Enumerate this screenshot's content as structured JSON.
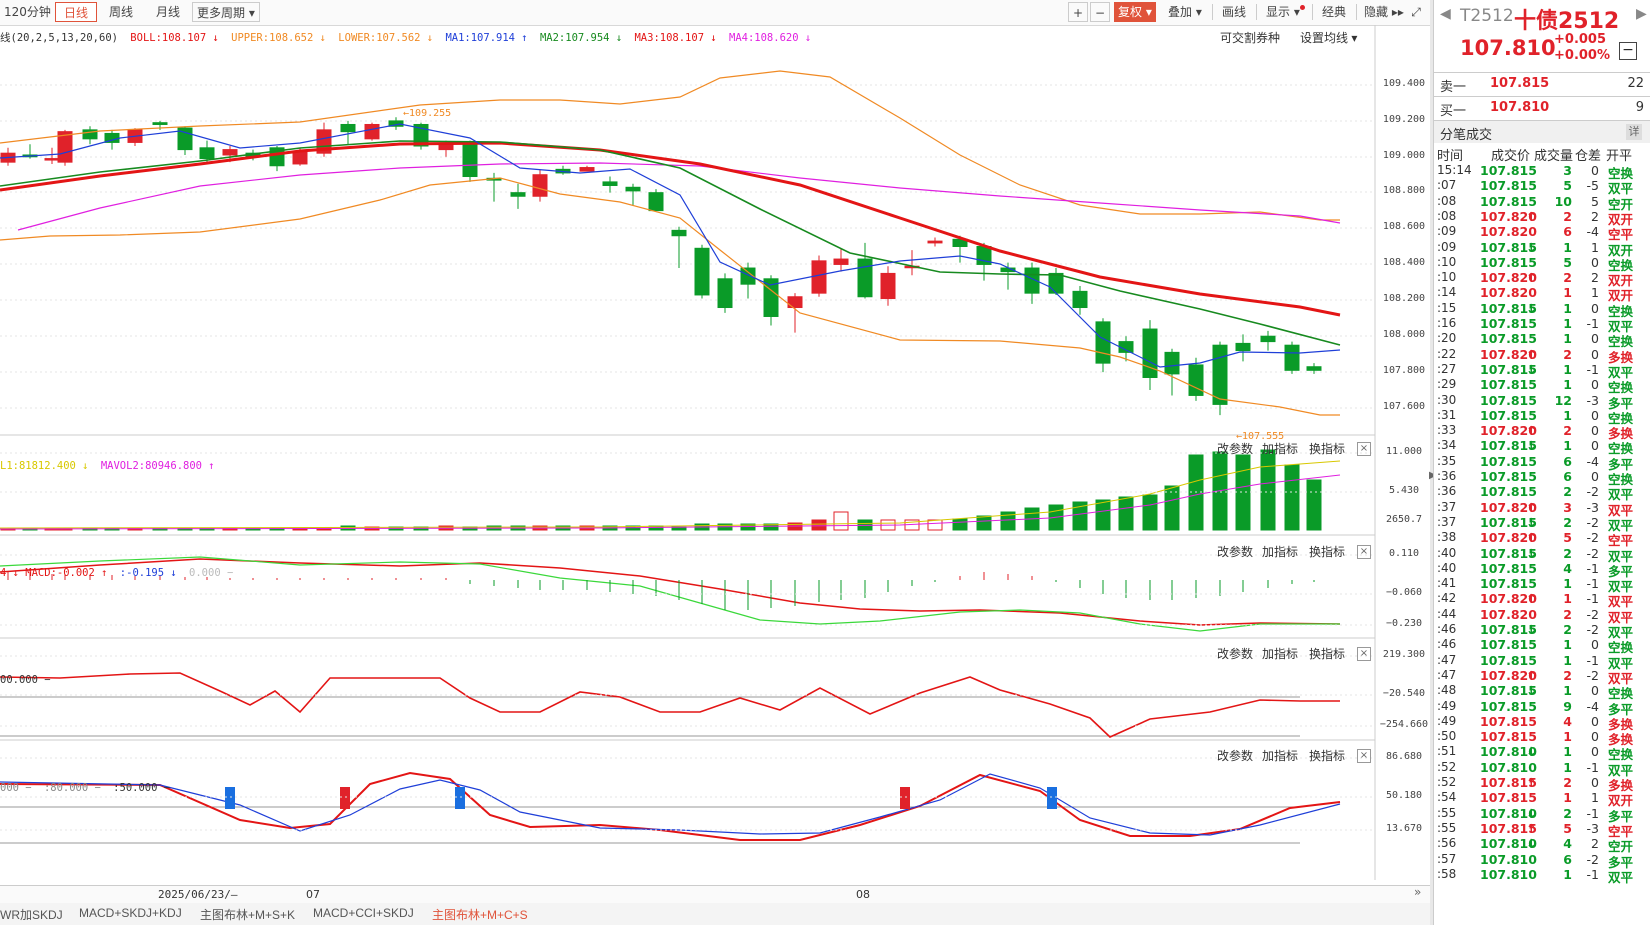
{
  "toolbar": {
    "periods": [
      "120分钟",
      "日线",
      "周线",
      "月线",
      "更多周期 ▾"
    ],
    "active_period": "日线",
    "right_tools": [
      "+",
      "−",
      "复权 ▾",
      "叠加 ▾",
      "画线",
      "显示 ▾",
      "经典",
      "隐藏 ▸▸",
      "⤢"
    ]
  },
  "legend_main": {
    "prefix": "线(20,2,5,13,20,60)",
    "boll": "BOLL:108.107 ↓",
    "upper": "UPPER:108.652 ↓",
    "lower": "LOWER:107.562 ↓",
    "ma1": "MA1:107.914 ↑",
    "ma2": "MA2:107.954 ↓",
    "ma3": "MA3:108.107 ↓",
    "ma4": "MA4:108.620 ↓",
    "link1": "可交割券种",
    "link2": "设置均线 ▾"
  },
  "main_axis": [
    "109.400",
    "109.200",
    "109.000",
    "108.800",
    "108.600",
    "108.400",
    "108.200",
    "108.000",
    "107.800",
    "107.600"
  ],
  "annot_high": "109.255",
  "annot_low": "107.555",
  "vol_legend": {
    "a": "L1:81812.400 ↓",
    "b": "MAVOL2:80946.800 ↑"
  },
  "vol_axis": [
    "11.000",
    "5.430",
    "2650.7"
  ],
  "macd_legend": {
    "a": "4 ↓ MACD:-0.002 ↑",
    "b": ":-0.195 ↓",
    "c": "0.000 −"
  },
  "macd_axis": [
    "0.110",
    "−0.060",
    "−0.230"
  ],
  "cci_legend": "00.000 −",
  "cci_axis": [
    "219.300",
    "−20.540",
    "−254.660"
  ],
  "kdj_legend": {
    "a": "000 − ",
    "b": ":80.000 −",
    "c": ":50.000 −"
  },
  "kdj_axis": [
    "86.680",
    "50.180",
    "13.670"
  ],
  "panel_buttons": [
    "改参数",
    "加指标",
    "换指标"
  ],
  "date_labels": {
    "start": "2025/06/23/—",
    "m07": "07",
    "m08": "08"
  },
  "bottom_tabs": [
    "WR加SKDJ",
    "MACD+SKDJ+KDJ",
    "主图布林+M+S+K",
    "MACD+CCI+SKDJ",
    "主图布林+M+C+S"
  ],
  "active_tab": "主图布林+M+C+S",
  "quote": {
    "code": "T2512",
    "name": "十债2512",
    "price": "107.810",
    "change": "+0.005",
    "change_pct": "+0.00%",
    "sell_label": "卖一",
    "sell_price": "107.815",
    "sell_vol": "22",
    "buy_label": "买一",
    "buy_price": "107.810",
    "buy_vol": "9"
  },
  "tick_panel": {
    "title": "分笔成交",
    "detail": "详",
    "headers": [
      "时间",
      "成交价",
      "成交量",
      "仓差",
      "开平"
    ]
  },
  "ticks": [
    {
      "t": "15:14",
      "p": "107.815",
      "a": "",
      "v": "3",
      "d": "0",
      "k": "空换",
      "c": "dn"
    },
    {
      "t": ":07",
      "p": "107.815",
      "a": "",
      "v": "5",
      "d": "-5",
      "k": "双平",
      "c": "dn"
    },
    {
      "t": ":08",
      "p": "107.815",
      "a": "",
      "v": "10",
      "d": "5",
      "k": "空开",
      "c": "dn"
    },
    {
      "t": ":08",
      "p": "107.820",
      "a": "↑",
      "v": "2",
      "d": "2",
      "k": "双开",
      "c": "up"
    },
    {
      "t": ":09",
      "p": "107.820",
      "a": "",
      "v": "6",
      "d": "-4",
      "k": "空平",
      "c": "up"
    },
    {
      "t": ":09",
      "p": "107.815",
      "a": "↓",
      "v": "1",
      "d": "1",
      "k": "双开",
      "c": "dn"
    },
    {
      "t": ":10",
      "p": "107.815",
      "a": "",
      "v": "5",
      "d": "0",
      "k": "空换",
      "c": "dn"
    },
    {
      "t": ":10",
      "p": "107.820",
      "a": "↑",
      "v": "2",
      "d": "2",
      "k": "双开",
      "c": "up"
    },
    {
      "t": ":14",
      "p": "107.820",
      "a": "",
      "v": "1",
      "d": "1",
      "k": "双开",
      "c": "up"
    },
    {
      "t": ":15",
      "p": "107.815",
      "a": "↓",
      "v": "1",
      "d": "0",
      "k": "空换",
      "c": "dn"
    },
    {
      "t": ":16",
      "p": "107.815",
      "a": "",
      "v": "1",
      "d": "-1",
      "k": "双平",
      "c": "dn"
    },
    {
      "t": ":20",
      "p": "107.815",
      "a": "",
      "v": "1",
      "d": "0",
      "k": "空换",
      "c": "dn"
    },
    {
      "t": ":22",
      "p": "107.820",
      "a": "↑",
      "v": "2",
      "d": "0",
      "k": "多换",
      "c": "up"
    },
    {
      "t": ":27",
      "p": "107.815",
      "a": "↓",
      "v": "1",
      "d": "-1",
      "k": "双平",
      "c": "dn"
    },
    {
      "t": ":29",
      "p": "107.815",
      "a": "",
      "v": "1",
      "d": "0",
      "k": "空换",
      "c": "dn"
    },
    {
      "t": ":30",
      "p": "107.815",
      "a": "",
      "v": "12",
      "d": "-3",
      "k": "多平",
      "c": "dn"
    },
    {
      "t": ":31",
      "p": "107.815",
      "a": "",
      "v": "1",
      "d": "0",
      "k": "空换",
      "c": "dn"
    },
    {
      "t": ":33",
      "p": "107.820",
      "a": "↑",
      "v": "2",
      "d": "0",
      "k": "多换",
      "c": "up"
    },
    {
      "t": ":34",
      "p": "107.815",
      "a": "↓",
      "v": "1",
      "d": "0",
      "k": "空换",
      "c": "dn"
    },
    {
      "t": ":35",
      "p": "107.815",
      "a": "",
      "v": "6",
      "d": "-4",
      "k": "多平",
      "c": "dn"
    },
    {
      "t": ":36",
      "p": "107.815",
      "a": "",
      "v": "6",
      "d": "0",
      "k": "空换",
      "c": "dn"
    },
    {
      "t": ":36",
      "p": "107.815",
      "a": "",
      "v": "2",
      "d": "-2",
      "k": "双平",
      "c": "dn"
    },
    {
      "t": ":37",
      "p": "107.820",
      "a": "↑",
      "v": "3",
      "d": "-3",
      "k": "双平",
      "c": "up"
    },
    {
      "t": ":37",
      "p": "107.815",
      "a": "↓",
      "v": "2",
      "d": "-2",
      "k": "双平",
      "c": "dn"
    },
    {
      "t": ":38",
      "p": "107.820",
      "a": "↑",
      "v": "5",
      "d": "-2",
      "k": "空平",
      "c": "up"
    },
    {
      "t": ":40",
      "p": "107.815",
      "a": "↓",
      "v": "2",
      "d": "-2",
      "k": "双平",
      "c": "dn"
    },
    {
      "t": ":40",
      "p": "107.815",
      "a": "",
      "v": "4",
      "d": "-1",
      "k": "多平",
      "c": "dn"
    },
    {
      "t": ":41",
      "p": "107.815",
      "a": "",
      "v": "1",
      "d": "-1",
      "k": "双平",
      "c": "dn"
    },
    {
      "t": ":42",
      "p": "107.820",
      "a": "↑",
      "v": "1",
      "d": "-1",
      "k": "双平",
      "c": "up"
    },
    {
      "t": ":44",
      "p": "107.820",
      "a": "",
      "v": "2",
      "d": "-2",
      "k": "双平",
      "c": "up"
    },
    {
      "t": ":46",
      "p": "107.815",
      "a": "↓",
      "v": "2",
      "d": "-2",
      "k": "双平",
      "c": "dn"
    },
    {
      "t": ":46",
      "p": "107.815",
      "a": "",
      "v": "1",
      "d": "0",
      "k": "空换",
      "c": "dn"
    },
    {
      "t": ":47",
      "p": "107.815",
      "a": "",
      "v": "1",
      "d": "-1",
      "k": "双平",
      "c": "dn"
    },
    {
      "t": ":47",
      "p": "107.820",
      "a": "↑",
      "v": "2",
      "d": "-2",
      "k": "双平",
      "c": "up"
    },
    {
      "t": ":48",
      "p": "107.815",
      "a": "↓",
      "v": "1",
      "d": "0",
      "k": "空换",
      "c": "dn"
    },
    {
      "t": ":49",
      "p": "107.815",
      "a": "",
      "v": "9",
      "d": "-4",
      "k": "多平",
      "c": "dn"
    },
    {
      "t": ":49",
      "p": "107.815",
      "a": "",
      "v": "4",
      "d": "0",
      "k": "多换",
      "c": "up"
    },
    {
      "t": ":50",
      "p": "107.815",
      "a": "",
      "v": "1",
      "d": "0",
      "k": "多换",
      "c": "up"
    },
    {
      "t": ":51",
      "p": "107.810",
      "a": "↓",
      "v": "1",
      "d": "0",
      "k": "空换",
      "c": "dn"
    },
    {
      "t": ":52",
      "p": "107.810",
      "a": "",
      "v": "1",
      "d": "-1",
      "k": "双平",
      "c": "dn"
    },
    {
      "t": ":52",
      "p": "107.815",
      "a": "↑",
      "v": "2",
      "d": "0",
      "k": "多换",
      "c": "up"
    },
    {
      "t": ":54",
      "p": "107.815",
      "a": "",
      "v": "1",
      "d": "1",
      "k": "双开",
      "c": "up"
    },
    {
      "t": ":55",
      "p": "107.810",
      "a": "↓",
      "v": "2",
      "d": "-1",
      "k": "多平",
      "c": "dn"
    },
    {
      "t": ":55",
      "p": "107.815",
      "a": "↑",
      "v": "5",
      "d": "-3",
      "k": "空平",
      "c": "up"
    },
    {
      "t": ":56",
      "p": "107.810",
      "a": "↓",
      "v": "4",
      "d": "2",
      "k": "空开",
      "c": "dn"
    },
    {
      "t": ":57",
      "p": "107.810",
      "a": "",
      "v": "6",
      "d": "-2",
      "k": "多平",
      "c": "dn"
    },
    {
      "t": ":58",
      "p": "107.810",
      "a": "",
      "v": "1",
      "d": "-1",
      "k": "双平",
      "c": "dn"
    }
  ],
  "colors": {
    "up": "#e0222a",
    "down": "#0a9b28",
    "boll": "#f08a24",
    "ma1": "#1f3fd8",
    "ma2": "#178a1f",
    "ma3": "#e31515",
    "ma4": "#e020e0"
  }
}
